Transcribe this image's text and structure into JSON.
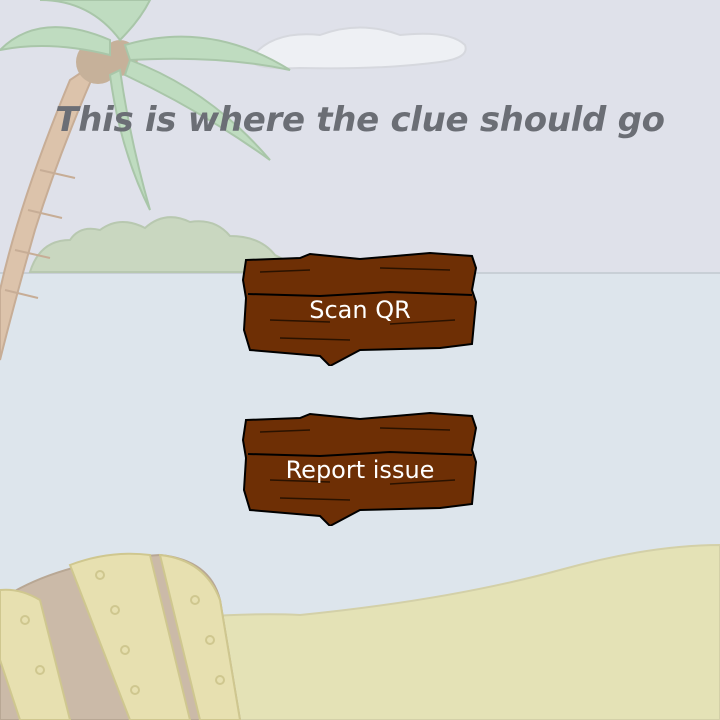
{
  "clue": {
    "text": "This is where the clue should go"
  },
  "buttons": {
    "scan_label": "Scan QR",
    "report_label": "Report issue"
  },
  "colors": {
    "sky": "#dfe3ea",
    "sea": "#dfe6ec",
    "sand": "#e4e2b8",
    "wood": "#6e2f05",
    "text_muted": "#6b6e75"
  },
  "icons": [
    "palm-tree-icon",
    "treasure-chest-icon",
    "island-icon",
    "cloud-icon"
  ]
}
